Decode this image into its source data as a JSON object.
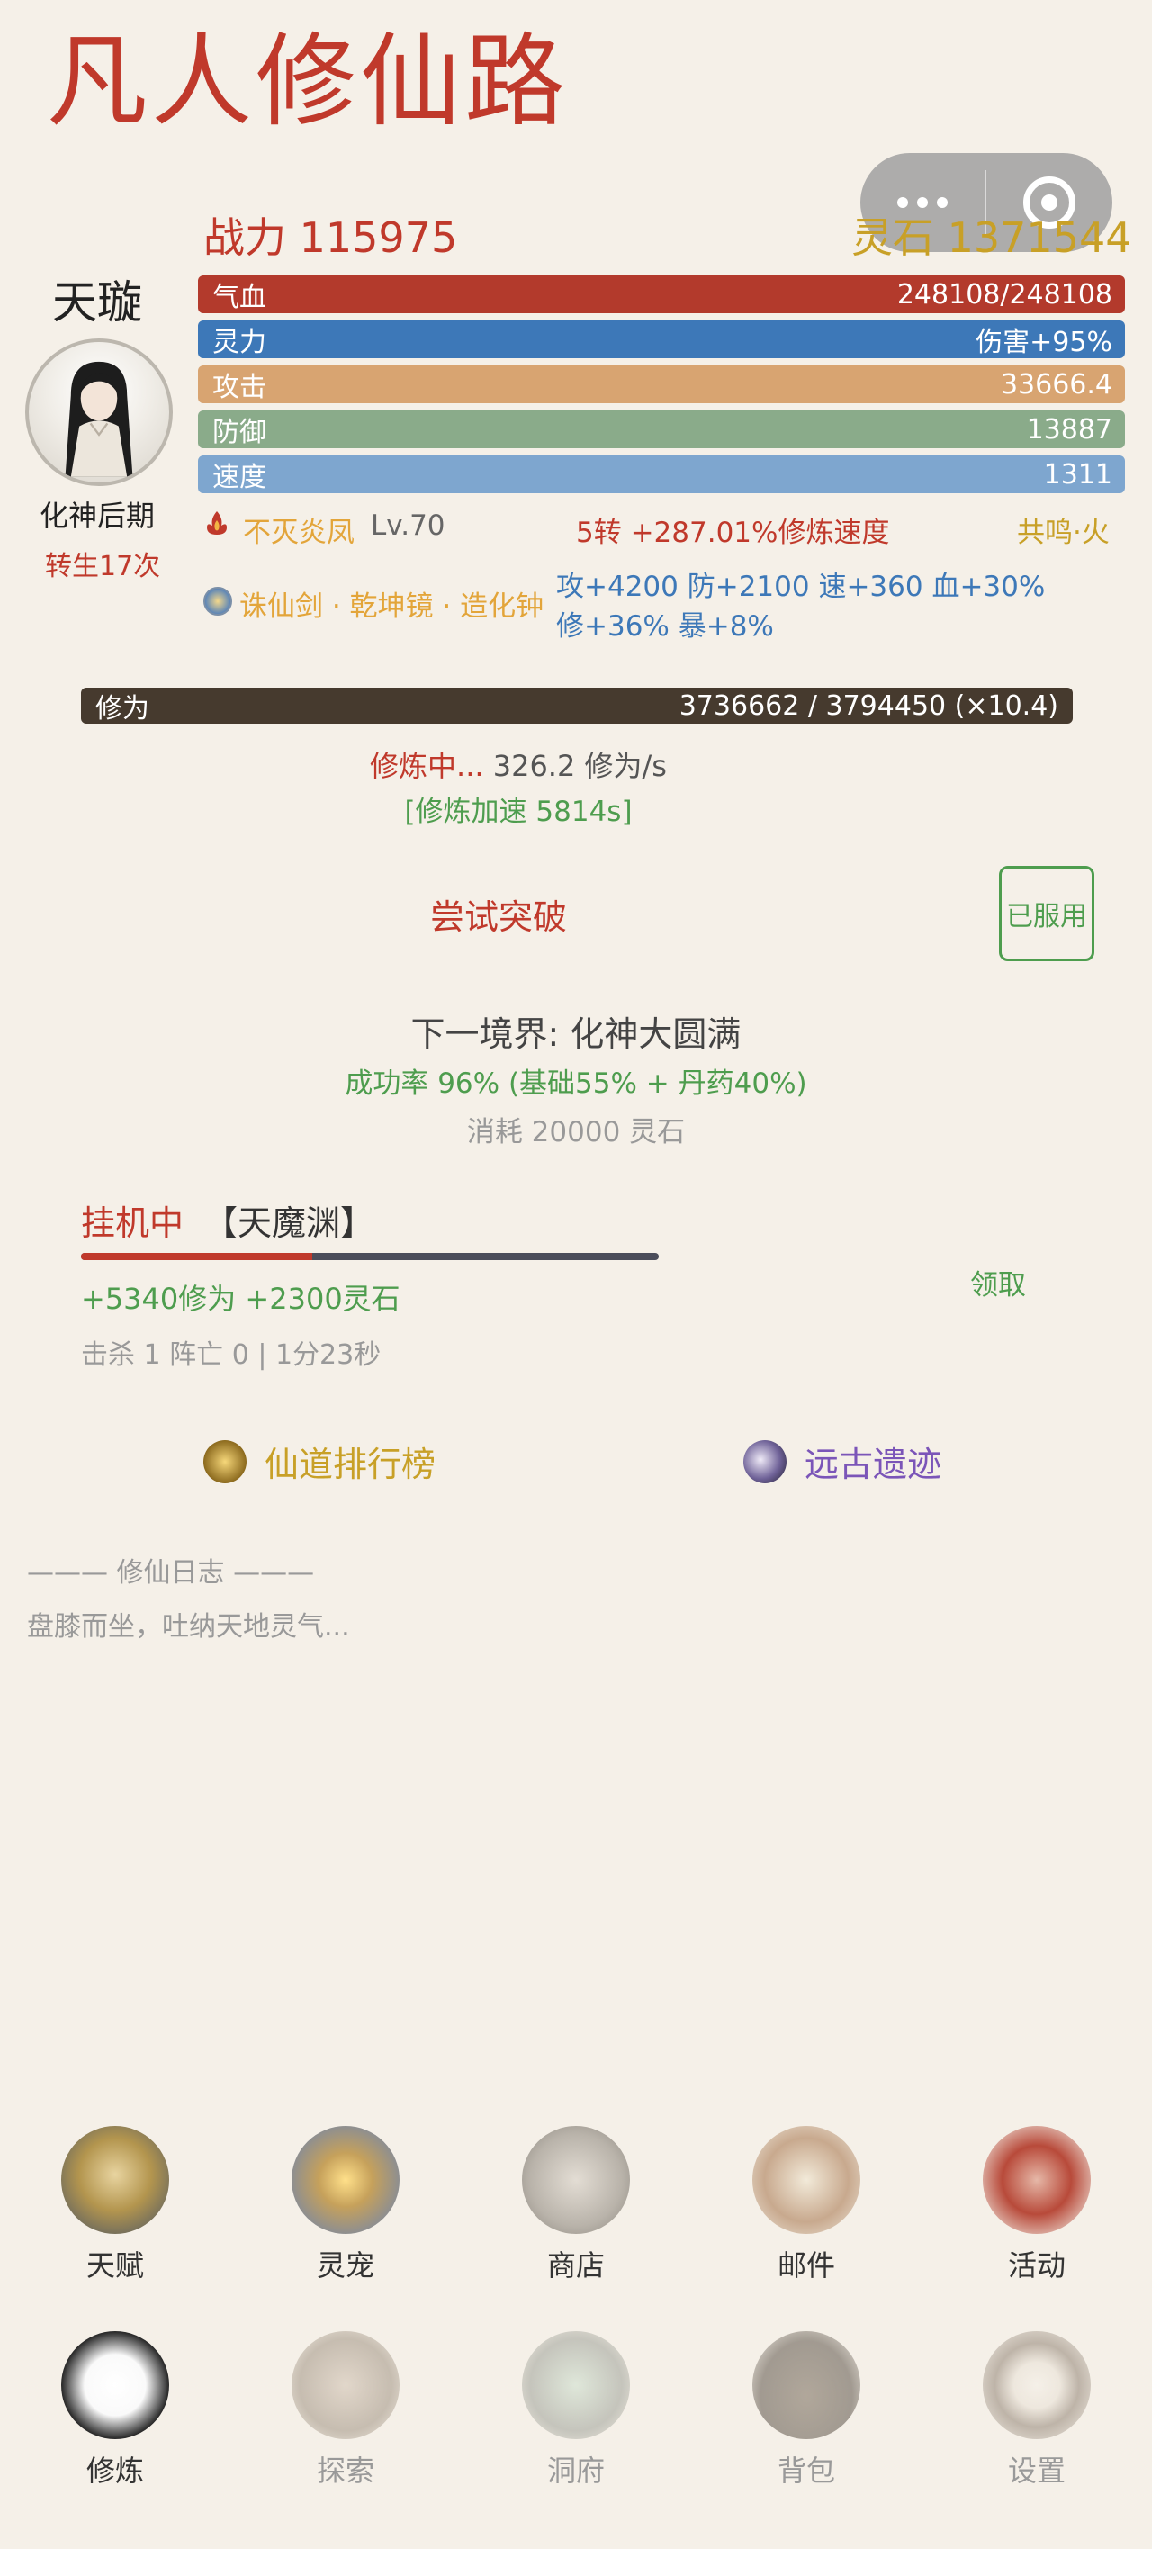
{
  "app": {
    "title": "凡人修仙路"
  },
  "header": {
    "power_label": "战力 115975",
    "stone_label": "灵石 1371544"
  },
  "profile": {
    "name": "天璇",
    "realm": "化神后期",
    "rebirth": "转生17次"
  },
  "stats": {
    "hp": {
      "label": "气血",
      "value": "248108/248108"
    },
    "mp": {
      "label": "灵力",
      "value": "伤害+95%"
    },
    "atk": {
      "label": "攻击",
      "value": "33666.4"
    },
    "def": {
      "label": "防御",
      "value": "13887"
    },
    "spd": {
      "label": "速度",
      "value": "1311"
    }
  },
  "skill": {
    "icon": "phoenix-flame-icon",
    "name": "不灭炎凤",
    "level": "Lv.70",
    "rebirth_bonus": "5转 +287.01%修炼速度",
    "resonance": "共鸣·火"
  },
  "equipment": {
    "icon": "treasure-orb-icon",
    "names": "诛仙剑 · 乾坤镜 · 造化钟",
    "bonus_line1": "攻+4200 防+2100 速+360 血+30%",
    "bonus_line2": "修+36% 暴+8%"
  },
  "cultivation": {
    "label": "修为",
    "value": "3736662 / 3794450 (×10.4)",
    "progress": 0.985,
    "status_prefix": "修炼中...",
    "status_rate": "326.2 修为/s",
    "boost": "[修炼加速 5814s]"
  },
  "breakthrough": {
    "button": "尝试突破",
    "pill_button": "已服用",
    "next_realm": "下一境界: 化神大圆满",
    "success_rate": "成功率 96% (基础55% + 丹药40%)",
    "cost": "消耗 20000 灵石"
  },
  "idle": {
    "label": "挂机中",
    "location": "【天魔渊】",
    "progress": 0.4,
    "gains": "+5340修为  +2300灵石",
    "claim": "领取",
    "stats": "击杀 1  阵亡 0  |  1分23秒"
  },
  "links": {
    "ranking": "仙道排行榜",
    "ruins": "远古遗迹"
  },
  "log": {
    "title": "——— 修仙日志 ———",
    "entry": "盘膝而坐，吐纳天地灵气..."
  },
  "nav": {
    "row1": [
      {
        "label": "天赋",
        "icon": "talent-tree-icon"
      },
      {
        "label": "灵宠",
        "icon": "spirit-pet-icon"
      },
      {
        "label": "商店",
        "icon": "shop-icon"
      },
      {
        "label": "邮件",
        "icon": "mail-icon"
      },
      {
        "label": "活动",
        "icon": "event-icon"
      }
    ],
    "row2": [
      {
        "label": "修炼",
        "icon": "cultivate-icon"
      },
      {
        "label": "探索",
        "icon": "explore-icon"
      },
      {
        "label": "洞府",
        "icon": "cave-icon"
      },
      {
        "label": "背包",
        "icon": "bag-icon"
      },
      {
        "label": "设置",
        "icon": "settings-icon"
      }
    ]
  },
  "colors": {
    "background": "#f5f0e8",
    "accent_red": "#c0392b",
    "gold": "#c8a027",
    "green": "#4e9d4e"
  }
}
